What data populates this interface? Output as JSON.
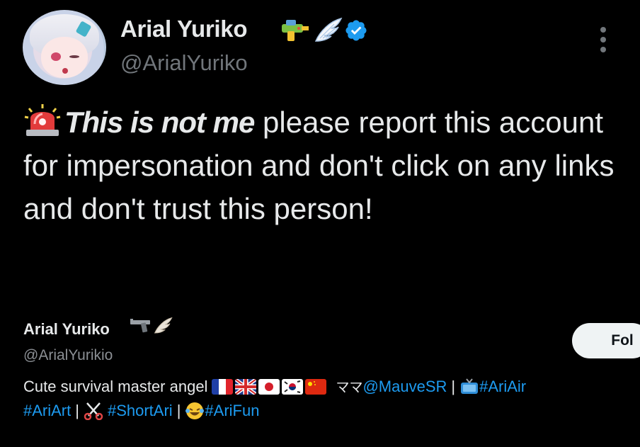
{
  "author": {
    "display_name": "Arial Yuriko",
    "handle": "@ArialYuriko",
    "badge_icons": [
      "water-gun-icon",
      "wing-icon",
      "verified-icon"
    ]
  },
  "tweet": {
    "emphasis": "This is not me",
    "text": " please report this account for impersonation and don't click on any links and don't trust this person!",
    "leading_icon": "police-siren-icon"
  },
  "profile_card": {
    "display_name": "Arial Yuriko",
    "handle": "@ArialYurikio",
    "badge_icons": [
      "gun-icon",
      "wing-icon"
    ],
    "follow_label": "Fol",
    "bio_line1_text": "Cute survival master angel",
    "bio_flags": [
      "france-flag",
      "uk-flag",
      "japan-flag",
      "korea-flag",
      "china-flag"
    ],
    "bio_mention_prefix": "ママ",
    "bio_mention": "@MauveSR",
    "bio_sep": "|",
    "bio_hashtag1": "#AriAir",
    "bio_hashtag2": "#AriArt",
    "bio_hashtag3": "#ShortAri",
    "bio_hashtag4": "#AriFun"
  },
  "colors": {
    "background": "#000000",
    "text": "#e7e9ea",
    "muted": "#71767b",
    "link": "#1d9bf0",
    "verified": "#1d9bf0"
  }
}
